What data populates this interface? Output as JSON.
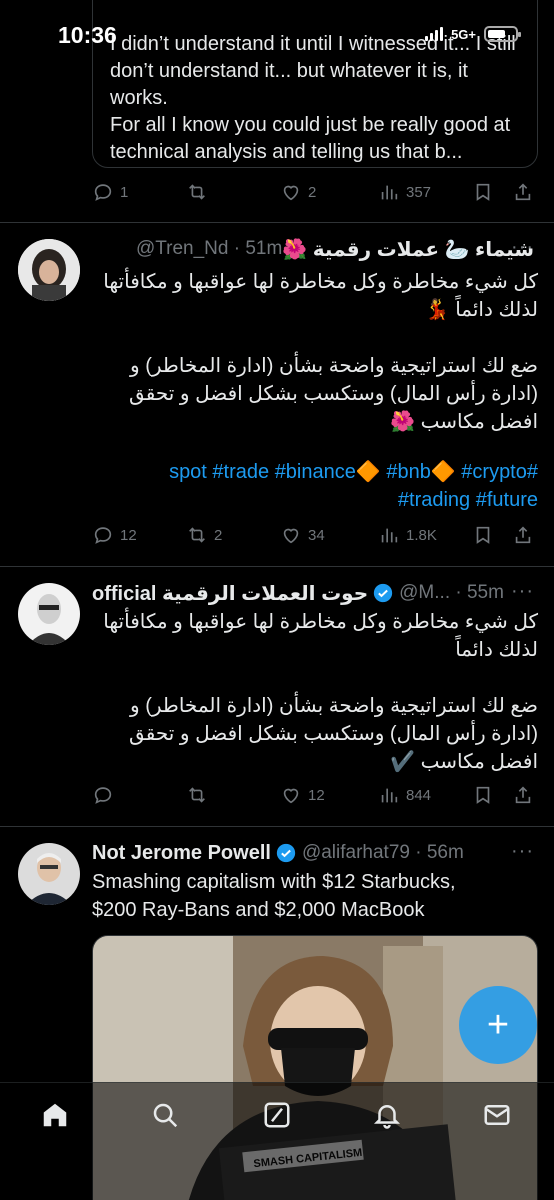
{
  "status": {
    "time": "10:36",
    "network": "5G+"
  },
  "quote": {
    "text": "I didn’t understand it until I witnessed it... I still don’t understand it... but whatever it is, it works.\nFor all I know you could just be really good at technical analysis and telling us that b..."
  },
  "top_actions": {
    "replies": "1",
    "retweets": "",
    "likes": "2",
    "views": "357"
  },
  "tweets": [
    {
      "name": "شيماء 🦢 عملات رقمية 🌺",
      "handle": "@Tren_Nd · 51m",
      "body": "كل شيء مخاطرة وكل مخاطرة لها عواقبها و مكافأتها لذلك دائماً 💃\n\nضع لك استراتيجية واضحة بشأن (ادارة المخاطر) و (ادارة رأس المال) وستكسب بشكل افضل و تحقق افضل مكاسب 🌺",
      "hashtags": "#spot #trade #binance🔶 #bnb🔶 #crypto #trading #future",
      "replies": "12",
      "retweets": "2",
      "likes": "34",
      "views": "1.8K"
    },
    {
      "name": "official حوت العملات الرقمية",
      "handle": "@M... · 55m",
      "body": "كل شيء مخاطرة وكل مخاطرة لها عواقبها و مكافأتها لذلك دائماً\n\nضع لك استراتيجية واضحة بشأن (ادارة المخاطر) و (ادارة رأس المال) وستكسب بشكل افضل و تحقق افضل مكاسب ✔️",
      "replies": "",
      "retweets": "",
      "likes": "12",
      "views": "844"
    },
    {
      "name": "Not Jerome Powell",
      "handle": "@alifarhat79 · 56m",
      "body": "Smashing capitalism with $12 Starbucks,\n$200 Ray-Bans and $2,000 MacBook",
      "media_sticker": "SMASH CAPITALISM"
    }
  ],
  "fab": {
    "label": "+"
  },
  "colors": {
    "accent": "#1d9bf0",
    "muted": "#71767b",
    "text": "#e7e9ea",
    "border": "#2f3336"
  },
  "nav": [
    "home-icon",
    "search-icon",
    "grok-icon",
    "notifications-icon",
    "messages-icon"
  ]
}
